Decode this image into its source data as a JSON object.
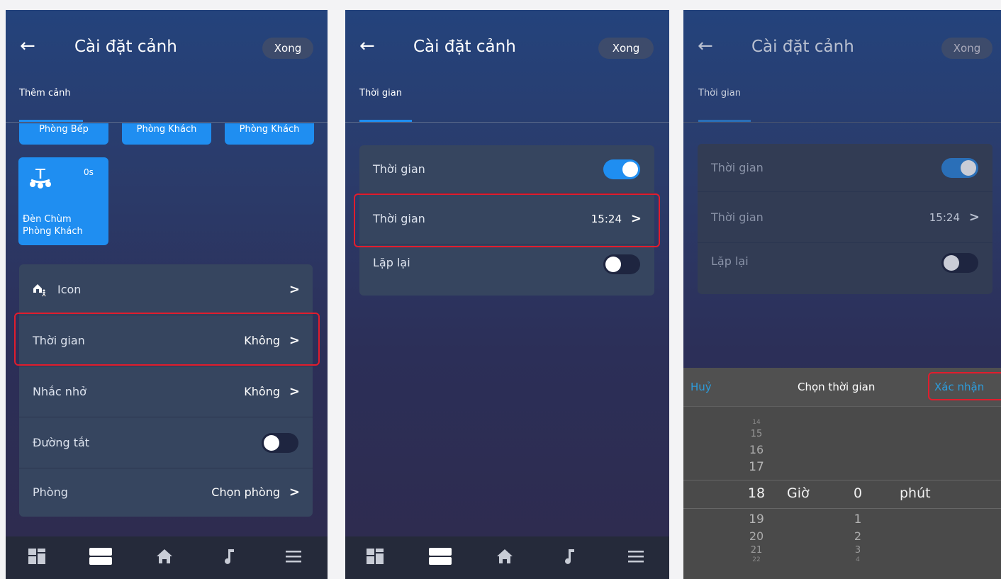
{
  "common": {
    "title": "Cài đặt cảnh",
    "done": "Xong"
  },
  "screen1": {
    "tab": "Thêm cảnh",
    "chips": [
      "Phòng Bếp",
      "Phòng Khách",
      "Phòng Khách"
    ],
    "tile": {
      "label1": "Đèn Chùm",
      "label2": "Phòng Khách",
      "delay": "0s",
      "icon": "chandelier-icon"
    },
    "rows": [
      {
        "label": "Icon",
        "value": ""
      },
      {
        "label": "Thời gian",
        "value": "Không"
      },
      {
        "label": "Nhắc nhở",
        "value": "Không"
      },
      {
        "label": "Đường tắt",
        "value": ""
      },
      {
        "label": "Phòng",
        "value": "Chọn phòng"
      }
    ],
    "shortcut_on": false
  },
  "screen2": {
    "tab": "Thời gian",
    "rows": [
      {
        "label": "Thời gian",
        "value": ""
      },
      {
        "label": "Thời gian",
        "value": "15:24"
      },
      {
        "label": "Lặp lại",
        "value": ""
      }
    ],
    "time_on": true,
    "repeat_on": false
  },
  "screen3": {
    "tab": "Thời gian",
    "rows": [
      {
        "label": "Thời gian",
        "value": ""
      },
      {
        "label": "Thời gian",
        "value": "15:24"
      },
      {
        "label": "Lặp lại",
        "value": ""
      }
    ],
    "picker": {
      "cancel": "Huỷ",
      "title": "Chọn thời gian",
      "confirm": "Xác nhận",
      "hour_unit": "Giờ",
      "minute_unit": "phút",
      "hours": [
        "14",
        "15",
        "16",
        "17",
        "18",
        "19",
        "20",
        "21",
        "22"
      ],
      "minutes": [
        "0",
        "1",
        "2",
        "3",
        "4"
      ]
    }
  },
  "bottom_nav": [
    "dashboard-icon",
    "scenes-icon",
    "home-icon",
    "music-icon",
    "menu-icon"
  ],
  "colors": {
    "accent": "#1f8ef1",
    "highlight": "#e11d2d",
    "card": "#36455f"
  }
}
